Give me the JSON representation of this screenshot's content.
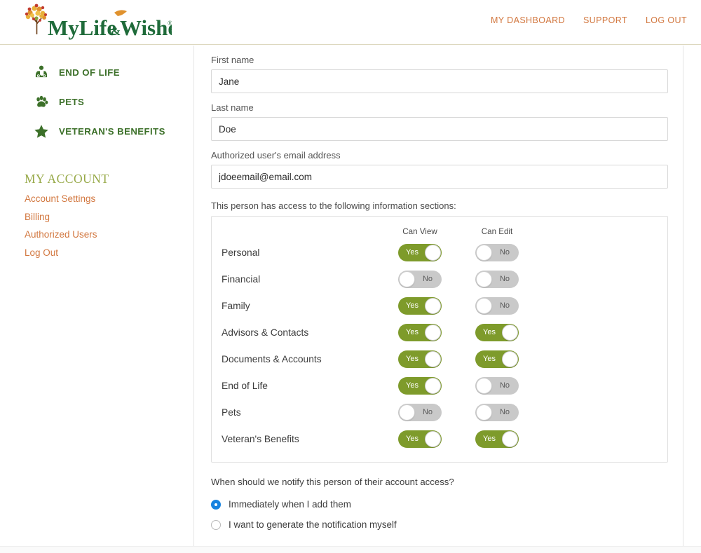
{
  "header": {
    "logo_text": "MyLife&Wishes",
    "nav": [
      {
        "label": "MY DASHBOARD",
        "name": "my-dashboard"
      },
      {
        "label": "SUPPORT",
        "name": "support"
      },
      {
        "label": "LOG OUT",
        "name": "log-out"
      }
    ],
    "accent_color": "#d2773f",
    "border_color": "#ddd8bf"
  },
  "sidebar": {
    "nav_items": [
      {
        "label": "END OF LIFE",
        "icon": "doctor-icon"
      },
      {
        "label": "PETS",
        "icon": "paw-icon"
      },
      {
        "label": "VETERAN'S BENEFITS",
        "icon": "star-icon"
      }
    ],
    "account_title": "MY ACCOUNT",
    "account_links": [
      "Account Settings",
      "Billing",
      "Authorized Users",
      "Log Out"
    ],
    "nav_color": "#3c7029",
    "account_title_color": "#97a948",
    "link_color": "#d2773f"
  },
  "form": {
    "first_name": {
      "label": "First name",
      "value": "Jane",
      "placeholder": "First name"
    },
    "last_name": {
      "label": "Last name",
      "value": "Doe",
      "placeholder": "Last name"
    },
    "email": {
      "label": "Authorized user's email address",
      "value": "jdoeemail@email.com",
      "placeholder": "Email address"
    },
    "access_note": "This person has access to the following information sections:"
  },
  "permissions": {
    "columns": [
      "Can View",
      "Can Edit"
    ],
    "on_label": "Yes",
    "off_label": "No",
    "on_color": "#7e9b2b",
    "off_color": "#c9c9c9",
    "rows": [
      {
        "name": "Personal",
        "can_view": true,
        "can_edit": false
      },
      {
        "name": "Financial",
        "can_view": false,
        "can_edit": false
      },
      {
        "name": "Family",
        "can_view": true,
        "can_edit": false
      },
      {
        "name": "Advisors & Contacts",
        "can_view": true,
        "can_edit": true
      },
      {
        "name": "Documents & Accounts",
        "can_view": true,
        "can_edit": true
      },
      {
        "name": "End of Life",
        "can_view": true,
        "can_edit": false
      },
      {
        "name": "Pets",
        "can_view": false,
        "can_edit": false
      },
      {
        "name": "Veteran's Benefits",
        "can_view": true,
        "can_edit": true
      }
    ]
  },
  "notify": {
    "question": "When should we notify this person of their account access?",
    "options": [
      {
        "label": "Immediately when I add them",
        "selected": true
      },
      {
        "label": "I want to generate the notification myself",
        "selected": false
      }
    ],
    "selected_color": "#1683e0"
  }
}
